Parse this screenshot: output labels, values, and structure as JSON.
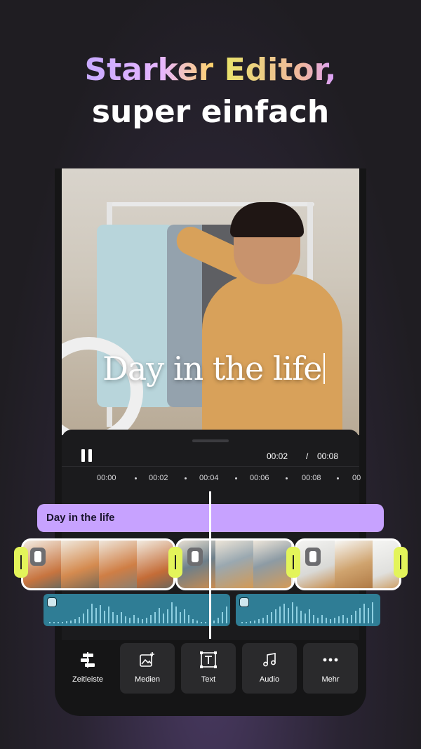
{
  "headline": {
    "line1_a": "Starker",
    "line1_b": "Editor,",
    "line2": "super einfach"
  },
  "video": {
    "overlay_text": "Day in the life"
  },
  "player": {
    "current_time": "00:02",
    "separator": "/",
    "total_time": "00:08"
  },
  "timeline": {
    "ticks": [
      "00:00",
      "00:02",
      "00:04",
      "00:06",
      "00:08",
      "00"
    ],
    "text_clip_label": "Day in the life"
  },
  "toolbar": {
    "items": [
      {
        "label": "Zeitleiste",
        "icon": "timeline-icon"
      },
      {
        "label": "Medien",
        "icon": "add-media-icon"
      },
      {
        "label": "Text",
        "icon": "text-icon"
      },
      {
        "label": "Audio",
        "icon": "music-icon"
      },
      {
        "label": "Mehr",
        "icon": "more-icon"
      }
    ]
  },
  "colors": {
    "accent_purple": "#c7a2ff",
    "handle_yellow": "#e3f45a",
    "audio_teal": "#2f7d95"
  }
}
